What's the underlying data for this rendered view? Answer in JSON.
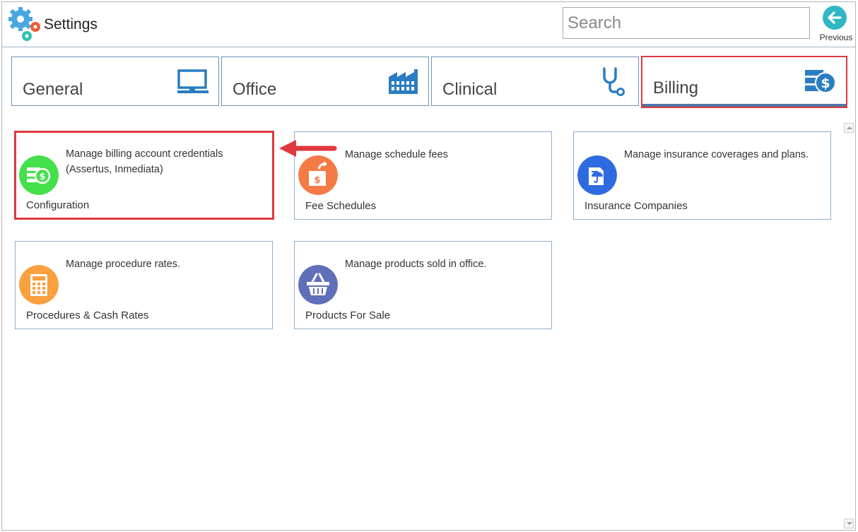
{
  "header": {
    "title": "Settings",
    "logo_icon": "gear-cluster-icon",
    "search_placeholder": "Search",
    "previous_label": "Previous"
  },
  "tabs": [
    {
      "label": "General",
      "icon": "monitor-icon",
      "active": false
    },
    {
      "label": "Office",
      "icon": "factory-icon",
      "active": false
    },
    {
      "label": "Clinical",
      "icon": "stethoscope-icon",
      "active": false
    },
    {
      "label": "Billing",
      "icon": "billing-icon",
      "active": true
    }
  ],
  "cards": [
    {
      "title": "Configuration",
      "description": "Manage billing account credentials (Assertus, Inmediata)",
      "icon": "money-stack-icon",
      "icon_color": "#44e04b",
      "highlighted": true
    },
    {
      "title": "Fee Schedules",
      "description": "Manage schedule fees",
      "icon": "price-tag-icon",
      "icon_color": "#f47b45",
      "highlighted": false
    },
    {
      "title": "Insurance Companies",
      "description": "Manage insurance coverages and plans.",
      "icon": "insurance-document-icon",
      "icon_color": "#2f6be0",
      "highlighted": false
    },
    {
      "title": "Procedures & Cash Rates",
      "description": "Manage procedure rates.",
      "icon": "calculator-icon",
      "icon_color": "#f9a03f",
      "highlighted": false
    },
    {
      "title": "Products For Sale",
      "description": "Manage products sold in office.",
      "icon": "basket-icon",
      "icon_color": "#5f6fb8",
      "highlighted": false
    }
  ],
  "colors": {
    "accent_blue": "#2a7dc2",
    "highlight_red": "#e0383e",
    "previous_teal": "#2fb8c4"
  }
}
